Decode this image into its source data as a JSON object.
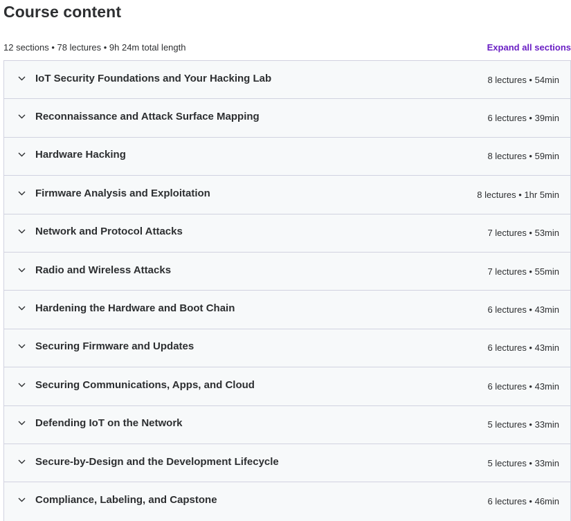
{
  "header": {
    "title": "Course content",
    "summary": "12 sections • 78 lectures • 9h 24m total length",
    "expand_label": "Expand all sections",
    "accent_color": "#6a1fc4"
  },
  "sections": [
    {
      "title": "IoT Security Foundations and Your Hacking Lab",
      "info": "8 lectures • 54min",
      "icon": "chevron-down-icon"
    },
    {
      "title": "Reconnaissance and Attack Surface Mapping",
      "info": "6 lectures • 39min",
      "icon": "chevron-down-icon"
    },
    {
      "title": "Hardware Hacking",
      "info": "8 lectures • 59min",
      "icon": "chevron-down-icon"
    },
    {
      "title": "Firmware Analysis and Exploitation",
      "info": "8 lectures • 1hr 5min",
      "icon": "chevron-down-icon"
    },
    {
      "title": "Network and Protocol Attacks",
      "info": "7 lectures • 53min",
      "icon": "chevron-down-icon"
    },
    {
      "title": "Radio and Wireless Attacks",
      "info": "7 lectures • 55min",
      "icon": "chevron-down-icon"
    },
    {
      "title": "Hardening the Hardware and Boot Chain",
      "info": "6 lectures • 43min",
      "icon": "chevron-down-icon"
    },
    {
      "title": "Securing Firmware and Updates",
      "info": "6 lectures • 43min",
      "icon": "chevron-down-icon"
    },
    {
      "title": "Securing Communications, Apps, and Cloud",
      "info": "6 lectures • 43min",
      "icon": "chevron-down-icon"
    },
    {
      "title": "Defending IoT on the Network",
      "info": "5 lectures • 33min",
      "icon": "chevron-down-icon"
    },
    {
      "title": "Secure-by-Design and the Development Lifecycle",
      "info": "5 lectures • 33min",
      "icon": "chevron-down-icon"
    },
    {
      "title": "Compliance, Labeling, and Capstone",
      "info": "6 lectures • 46min",
      "icon": "chevron-down-icon"
    }
  ]
}
